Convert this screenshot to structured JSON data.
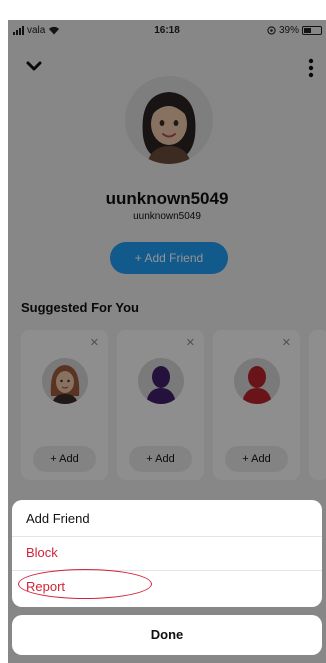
{
  "status_bar": {
    "carrier": "vala",
    "time": "16:18",
    "battery": "39%",
    "battery_level": 0.39
  },
  "profile": {
    "display_name": "uunknown5049",
    "username": "uunknown5049",
    "add_friend_label": "+ Add Friend"
  },
  "suggested": {
    "title": "Suggested For You",
    "cards": [
      {
        "add_label": "+ Add",
        "avatar_color": "#9b5a3c"
      },
      {
        "add_label": "+ Add",
        "avatar_color": "#3f1f6a"
      },
      {
        "add_label": "+ Add",
        "avatar_color": "#b3232a"
      }
    ]
  },
  "action_sheet": {
    "add_friend": "Add Friend",
    "block": "Block",
    "report": "Report",
    "done": "Done"
  },
  "colors": {
    "accent": "#1e9bef",
    "destructive": "#d2233a",
    "annotation": "#d2233a"
  }
}
